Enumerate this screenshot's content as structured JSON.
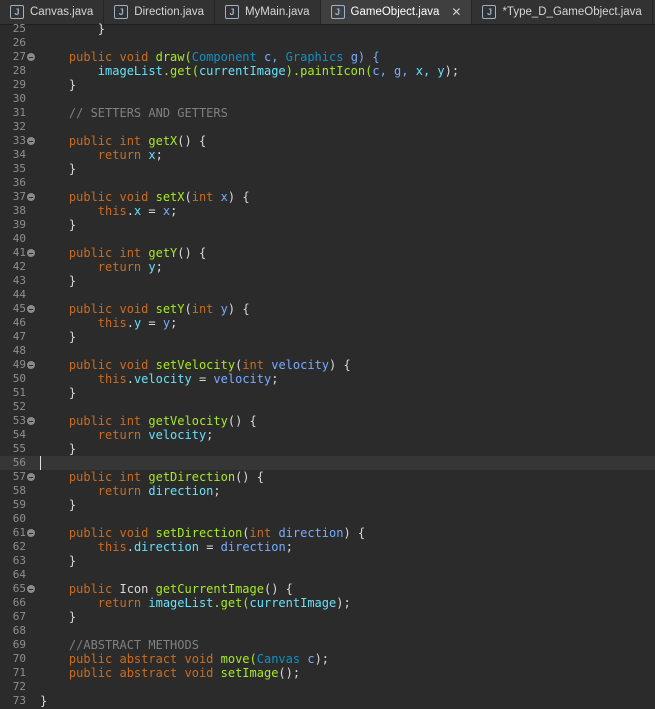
{
  "tabs": [
    {
      "label": "Canvas.java",
      "active": false
    },
    {
      "label": "Direction.java",
      "active": false
    },
    {
      "label": "MyMain.java",
      "active": false
    },
    {
      "label": "GameObject.java",
      "active": true,
      "closable": true
    },
    {
      "label": "*Type_D_GameObject.java",
      "active": false
    }
  ],
  "caret_line": 56,
  "lines": [
    {
      "num": "25",
      "fold": false,
      "tokens": [
        {
          "t": "        }",
          "c": "plain"
        }
      ]
    },
    {
      "num": "26",
      "fold": false,
      "tokens": []
    },
    {
      "num": "27",
      "fold": true,
      "tokens": [
        {
          "t": "    public void ",
          "c": "kw"
        },
        {
          "t": "draw(",
          "c": "fn"
        },
        {
          "t": "Component ",
          "c": "ty"
        },
        {
          "t": "c, ",
          "c": "pr"
        },
        {
          "t": "Graphics ",
          "c": "ty"
        },
        {
          "t": "g) {",
          "c": "pr"
        }
      ]
    },
    {
      "num": "28",
      "fold": false,
      "tokens": [
        {
          "t": "        ",
          "c": "plain"
        },
        {
          "t": "imageList",
          "c": "fld"
        },
        {
          "t": ".get(",
          "c": "fn"
        },
        {
          "t": "currentImage",
          "c": "fld"
        },
        {
          "t": ").paintIcon(",
          "c": "fn"
        },
        {
          "t": "c, g, ",
          "c": "pr"
        },
        {
          "t": "x, y",
          "c": "fld"
        },
        {
          "t": ");",
          "c": "plain"
        }
      ]
    },
    {
      "num": "29",
      "fold": false,
      "tokens": [
        {
          "t": "    }",
          "c": "plain"
        }
      ]
    },
    {
      "num": "30",
      "fold": false,
      "tokens": []
    },
    {
      "num": "31",
      "fold": false,
      "tokens": [
        {
          "t": "    // SETTERS AND GETTERS",
          "c": "cm"
        }
      ]
    },
    {
      "num": "32",
      "fold": false,
      "tokens": []
    },
    {
      "num": "33",
      "fold": true,
      "tokens": [
        {
          "t": "    public int ",
          "c": "kw"
        },
        {
          "t": "getX",
          "c": "fn"
        },
        {
          "t": "() {",
          "c": "plain"
        }
      ]
    },
    {
      "num": "34",
      "fold": false,
      "tokens": [
        {
          "t": "        return ",
          "c": "kw"
        },
        {
          "t": "x",
          "c": "fld"
        },
        {
          "t": ";",
          "c": "plain"
        }
      ]
    },
    {
      "num": "35",
      "fold": false,
      "tokens": [
        {
          "t": "    }",
          "c": "plain"
        }
      ]
    },
    {
      "num": "36",
      "fold": false,
      "tokens": []
    },
    {
      "num": "37",
      "fold": true,
      "tokens": [
        {
          "t": "    public void ",
          "c": "kw"
        },
        {
          "t": "setX",
          "c": "fn"
        },
        {
          "t": "(",
          "c": "plain"
        },
        {
          "t": "int ",
          "c": "kw"
        },
        {
          "t": "x",
          "c": "pr"
        },
        {
          "t": ") {",
          "c": "plain"
        }
      ]
    },
    {
      "num": "38",
      "fold": false,
      "tokens": [
        {
          "t": "        this",
          "c": "kw"
        },
        {
          "t": ".",
          "c": "plain"
        },
        {
          "t": "x",
          "c": "fld"
        },
        {
          "t": " = ",
          "c": "plain"
        },
        {
          "t": "x",
          "c": "pr"
        },
        {
          "t": ";",
          "c": "plain"
        }
      ]
    },
    {
      "num": "39",
      "fold": false,
      "tokens": [
        {
          "t": "    }",
          "c": "plain"
        }
      ]
    },
    {
      "num": "40",
      "fold": false,
      "tokens": []
    },
    {
      "num": "41",
      "fold": true,
      "tokens": [
        {
          "t": "    public int ",
          "c": "kw"
        },
        {
          "t": "getY",
          "c": "fn"
        },
        {
          "t": "() {",
          "c": "plain"
        }
      ]
    },
    {
      "num": "42",
      "fold": false,
      "tokens": [
        {
          "t": "        return ",
          "c": "kw"
        },
        {
          "t": "y",
          "c": "fld"
        },
        {
          "t": ";",
          "c": "plain"
        }
      ]
    },
    {
      "num": "43",
      "fold": false,
      "tokens": [
        {
          "t": "    }",
          "c": "plain"
        }
      ]
    },
    {
      "num": "44",
      "fold": false,
      "tokens": []
    },
    {
      "num": "45",
      "fold": true,
      "tokens": [
        {
          "t": "    public void ",
          "c": "kw"
        },
        {
          "t": "setY",
          "c": "fn"
        },
        {
          "t": "(",
          "c": "plain"
        },
        {
          "t": "int ",
          "c": "kw"
        },
        {
          "t": "y",
          "c": "pr"
        },
        {
          "t": ") {",
          "c": "plain"
        }
      ]
    },
    {
      "num": "46",
      "fold": false,
      "tokens": [
        {
          "t": "        this",
          "c": "kw"
        },
        {
          "t": ".",
          "c": "plain"
        },
        {
          "t": "y",
          "c": "fld"
        },
        {
          "t": " = ",
          "c": "plain"
        },
        {
          "t": "y",
          "c": "pr"
        },
        {
          "t": ";",
          "c": "plain"
        }
      ]
    },
    {
      "num": "47",
      "fold": false,
      "tokens": [
        {
          "t": "    }",
          "c": "plain"
        }
      ]
    },
    {
      "num": "48",
      "fold": false,
      "tokens": []
    },
    {
      "num": "49",
      "fold": true,
      "tokens": [
        {
          "t": "    public void ",
          "c": "kw"
        },
        {
          "t": "setVelocity",
          "c": "fn"
        },
        {
          "t": "(",
          "c": "plain"
        },
        {
          "t": "int ",
          "c": "kw"
        },
        {
          "t": "velocity",
          "c": "pr"
        },
        {
          "t": ") {",
          "c": "plain"
        }
      ]
    },
    {
      "num": "50",
      "fold": false,
      "tokens": [
        {
          "t": "        this",
          "c": "kw"
        },
        {
          "t": ".",
          "c": "plain"
        },
        {
          "t": "velocity",
          "c": "fld"
        },
        {
          "t": " = ",
          "c": "plain"
        },
        {
          "t": "velocity",
          "c": "pr"
        },
        {
          "t": ";",
          "c": "plain"
        }
      ]
    },
    {
      "num": "51",
      "fold": false,
      "tokens": [
        {
          "t": "    }",
          "c": "plain"
        }
      ]
    },
    {
      "num": "52",
      "fold": false,
      "tokens": []
    },
    {
      "num": "53",
      "fold": true,
      "tokens": [
        {
          "t": "    public int ",
          "c": "kw"
        },
        {
          "t": "getVelocity",
          "c": "fn"
        },
        {
          "t": "() {",
          "c": "plain"
        }
      ]
    },
    {
      "num": "54",
      "fold": false,
      "tokens": [
        {
          "t": "        return ",
          "c": "kw"
        },
        {
          "t": "velocity",
          "c": "fld"
        },
        {
          "t": ";",
          "c": "plain"
        }
      ]
    },
    {
      "num": "55",
      "fold": false,
      "tokens": [
        {
          "t": "    }",
          "c": "plain"
        }
      ]
    },
    {
      "num": "56",
      "fold": false,
      "tokens": []
    },
    {
      "num": "57",
      "fold": true,
      "tokens": [
        {
          "t": "    public int ",
          "c": "kw"
        },
        {
          "t": "getDirection",
          "c": "fn"
        },
        {
          "t": "() {",
          "c": "plain"
        }
      ]
    },
    {
      "num": "58",
      "fold": false,
      "tokens": [
        {
          "t": "        return ",
          "c": "kw"
        },
        {
          "t": "direction",
          "c": "fld"
        },
        {
          "t": ";",
          "c": "plain"
        }
      ]
    },
    {
      "num": "59",
      "fold": false,
      "tokens": [
        {
          "t": "    }",
          "c": "plain"
        }
      ]
    },
    {
      "num": "60",
      "fold": false,
      "tokens": []
    },
    {
      "num": "61",
      "fold": true,
      "tokens": [
        {
          "t": "    public void ",
          "c": "kw"
        },
        {
          "t": "setDirection",
          "c": "fn"
        },
        {
          "t": "(",
          "c": "plain"
        },
        {
          "t": "int ",
          "c": "kw"
        },
        {
          "t": "direction",
          "c": "pr"
        },
        {
          "t": ") {",
          "c": "plain"
        }
      ]
    },
    {
      "num": "62",
      "fold": false,
      "tokens": [
        {
          "t": "        this",
          "c": "kw"
        },
        {
          "t": ".",
          "c": "plain"
        },
        {
          "t": "direction",
          "c": "fld"
        },
        {
          "t": " = ",
          "c": "plain"
        },
        {
          "t": "direction",
          "c": "pr"
        },
        {
          "t": ";",
          "c": "plain"
        }
      ]
    },
    {
      "num": "63",
      "fold": false,
      "tokens": [
        {
          "t": "    }",
          "c": "plain"
        }
      ]
    },
    {
      "num": "64",
      "fold": false,
      "tokens": []
    },
    {
      "num": "65",
      "fold": true,
      "tokens": [
        {
          "t": "    public ",
          "c": "kw"
        },
        {
          "t": "Icon ",
          "c": "plain"
        },
        {
          "t": "getCurrentImage",
          "c": "fn"
        },
        {
          "t": "() {",
          "c": "plain"
        }
      ]
    },
    {
      "num": "66",
      "fold": false,
      "tokens": [
        {
          "t": "        return ",
          "c": "kw"
        },
        {
          "t": "imageList",
          "c": "fld"
        },
        {
          "t": ".get(",
          "c": "fn"
        },
        {
          "t": "currentImage",
          "c": "fld"
        },
        {
          "t": ");",
          "c": "plain"
        }
      ]
    },
    {
      "num": "67",
      "fold": false,
      "tokens": [
        {
          "t": "    }",
          "c": "plain"
        }
      ]
    },
    {
      "num": "68",
      "fold": false,
      "tokens": []
    },
    {
      "num": "69",
      "fold": false,
      "tokens": [
        {
          "t": "    //ABSTRACT METHODS",
          "c": "cm"
        }
      ]
    },
    {
      "num": "70",
      "fold": false,
      "tokens": [
        {
          "t": "    public abstract void ",
          "c": "kw"
        },
        {
          "t": "move(",
          "c": "fn"
        },
        {
          "t": "Canvas ",
          "c": "ty"
        },
        {
          "t": "c",
          "c": "pr"
        },
        {
          "t": ");",
          "c": "plain"
        }
      ]
    },
    {
      "num": "71",
      "fold": false,
      "tokens": [
        {
          "t": "    public abstract void ",
          "c": "kw"
        },
        {
          "t": "setImage",
          "c": "fn"
        },
        {
          "t": "();",
          "c": "plain"
        }
      ]
    },
    {
      "num": "72",
      "fold": false,
      "tokens": []
    },
    {
      "num": "73",
      "fold": false,
      "tokens": [
        {
          "t": "}",
          "c": "plain"
        }
      ]
    }
  ]
}
